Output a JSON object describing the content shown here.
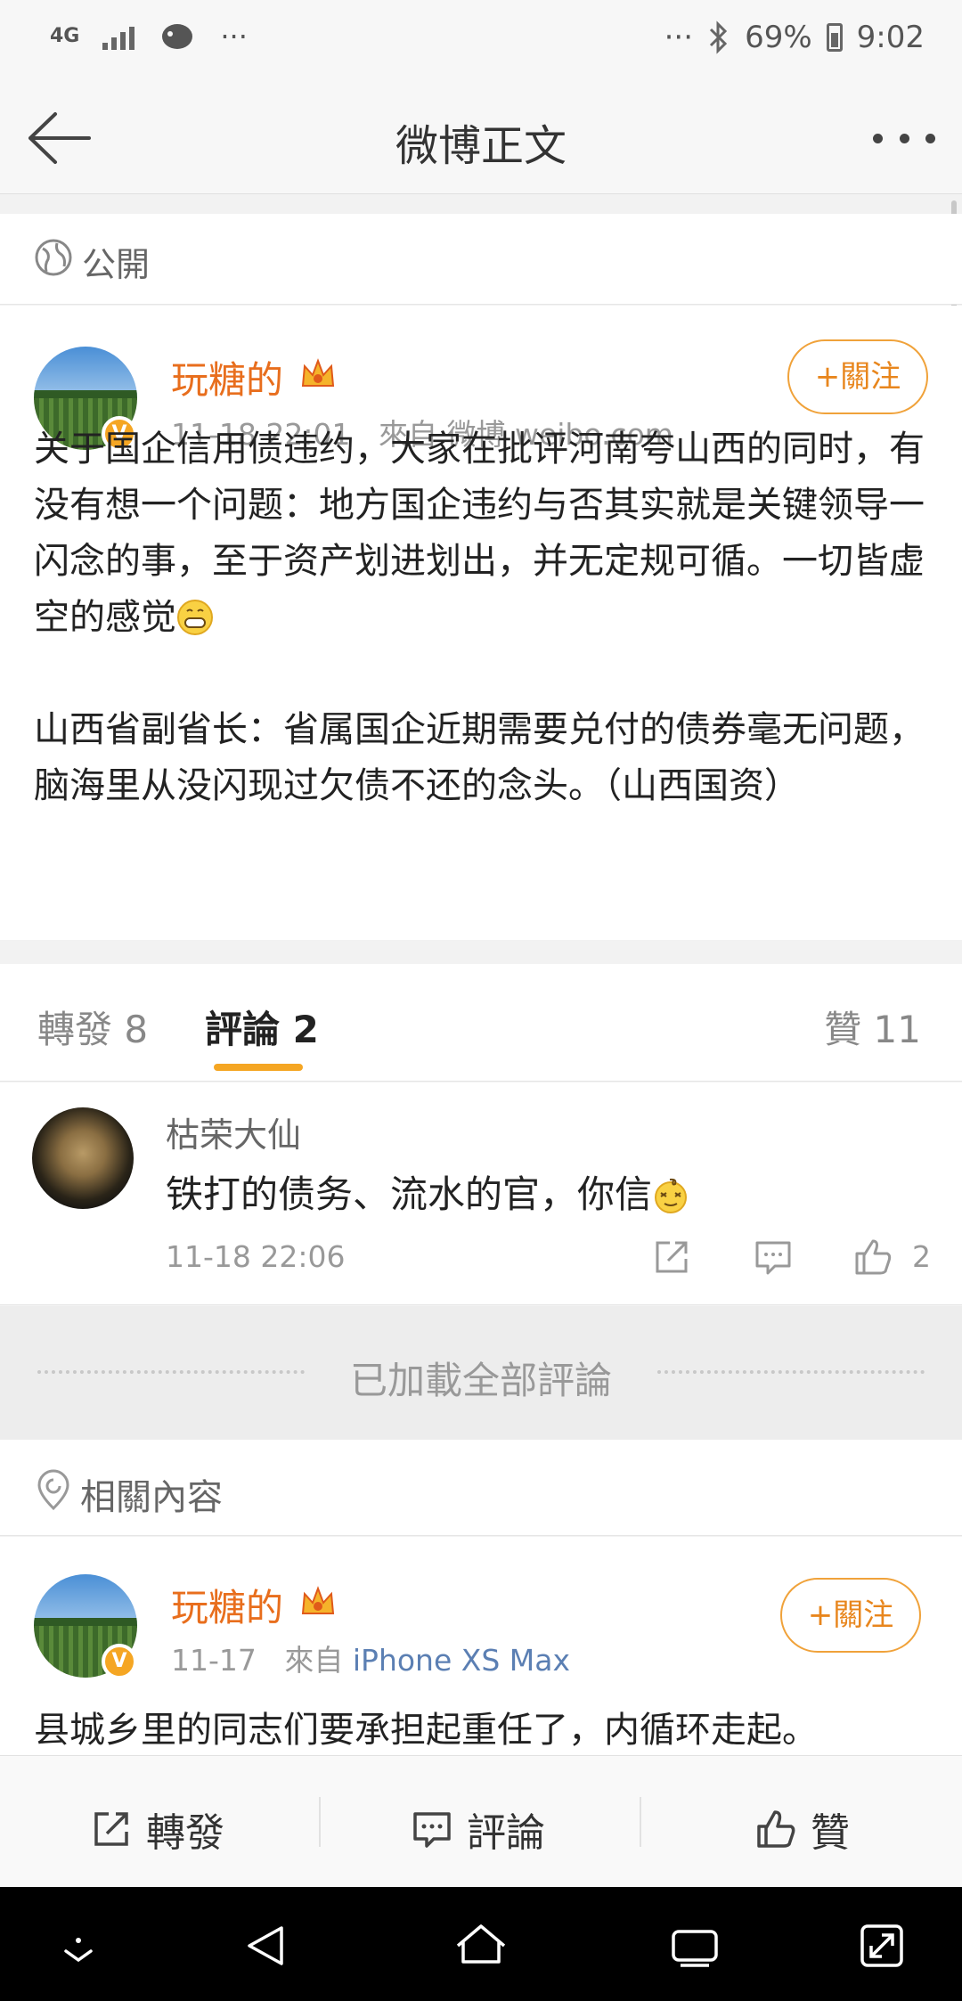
{
  "status_bar": {
    "network": "4G",
    "ellipsis_left": "···",
    "ellipsis_right": "···",
    "battery": "69%",
    "time": "9:02"
  },
  "nav": {
    "title": "微博正文"
  },
  "visibility": {
    "label": "公開"
  },
  "post": {
    "author": "玩糖的",
    "time": "11-18 22:01",
    "source_prefix": "來自",
    "source": "微博 weibo.com",
    "follow_label": "+關注",
    "paragraph1": "关于国企信用债违约，大家在批评河南夸山西的同时，有没有想一个问题：地方国企违约与否其实就是关键领导一闪念的事，至于资产划进划出，并无定规可循。一切皆虚空的感觉",
    "paragraph2": "山西省副省长：省属国企近期需要兑付的债券毫无问题，脑海里从没闪现过欠债不还的念头。（山西国资）"
  },
  "tabs": {
    "repost": "轉發 8",
    "comments": "評論 2",
    "likes": "贊 11"
  },
  "comment": {
    "user": "枯荣大仙",
    "text": "铁打的债务、流水的官，你信",
    "time": "11-18 22:06",
    "likes": "2"
  },
  "all_loaded": "已加載全部評論",
  "related": {
    "label": "相關內容"
  },
  "post2": {
    "author": "玩糖的",
    "time": "11-17",
    "source_prefix": "來自",
    "source": "iPhone XS Max",
    "follow_label": "+關注",
    "text": "县城乡里的同志们要承担起重任了，内循环走起。"
  },
  "action_bar": {
    "repost": "轉發",
    "comment": "評論",
    "like": "贊"
  },
  "colors": {
    "accent_orange": "#e86e1d",
    "tab_underline": "#f5a623",
    "link_blue": "#5b7fb3"
  }
}
